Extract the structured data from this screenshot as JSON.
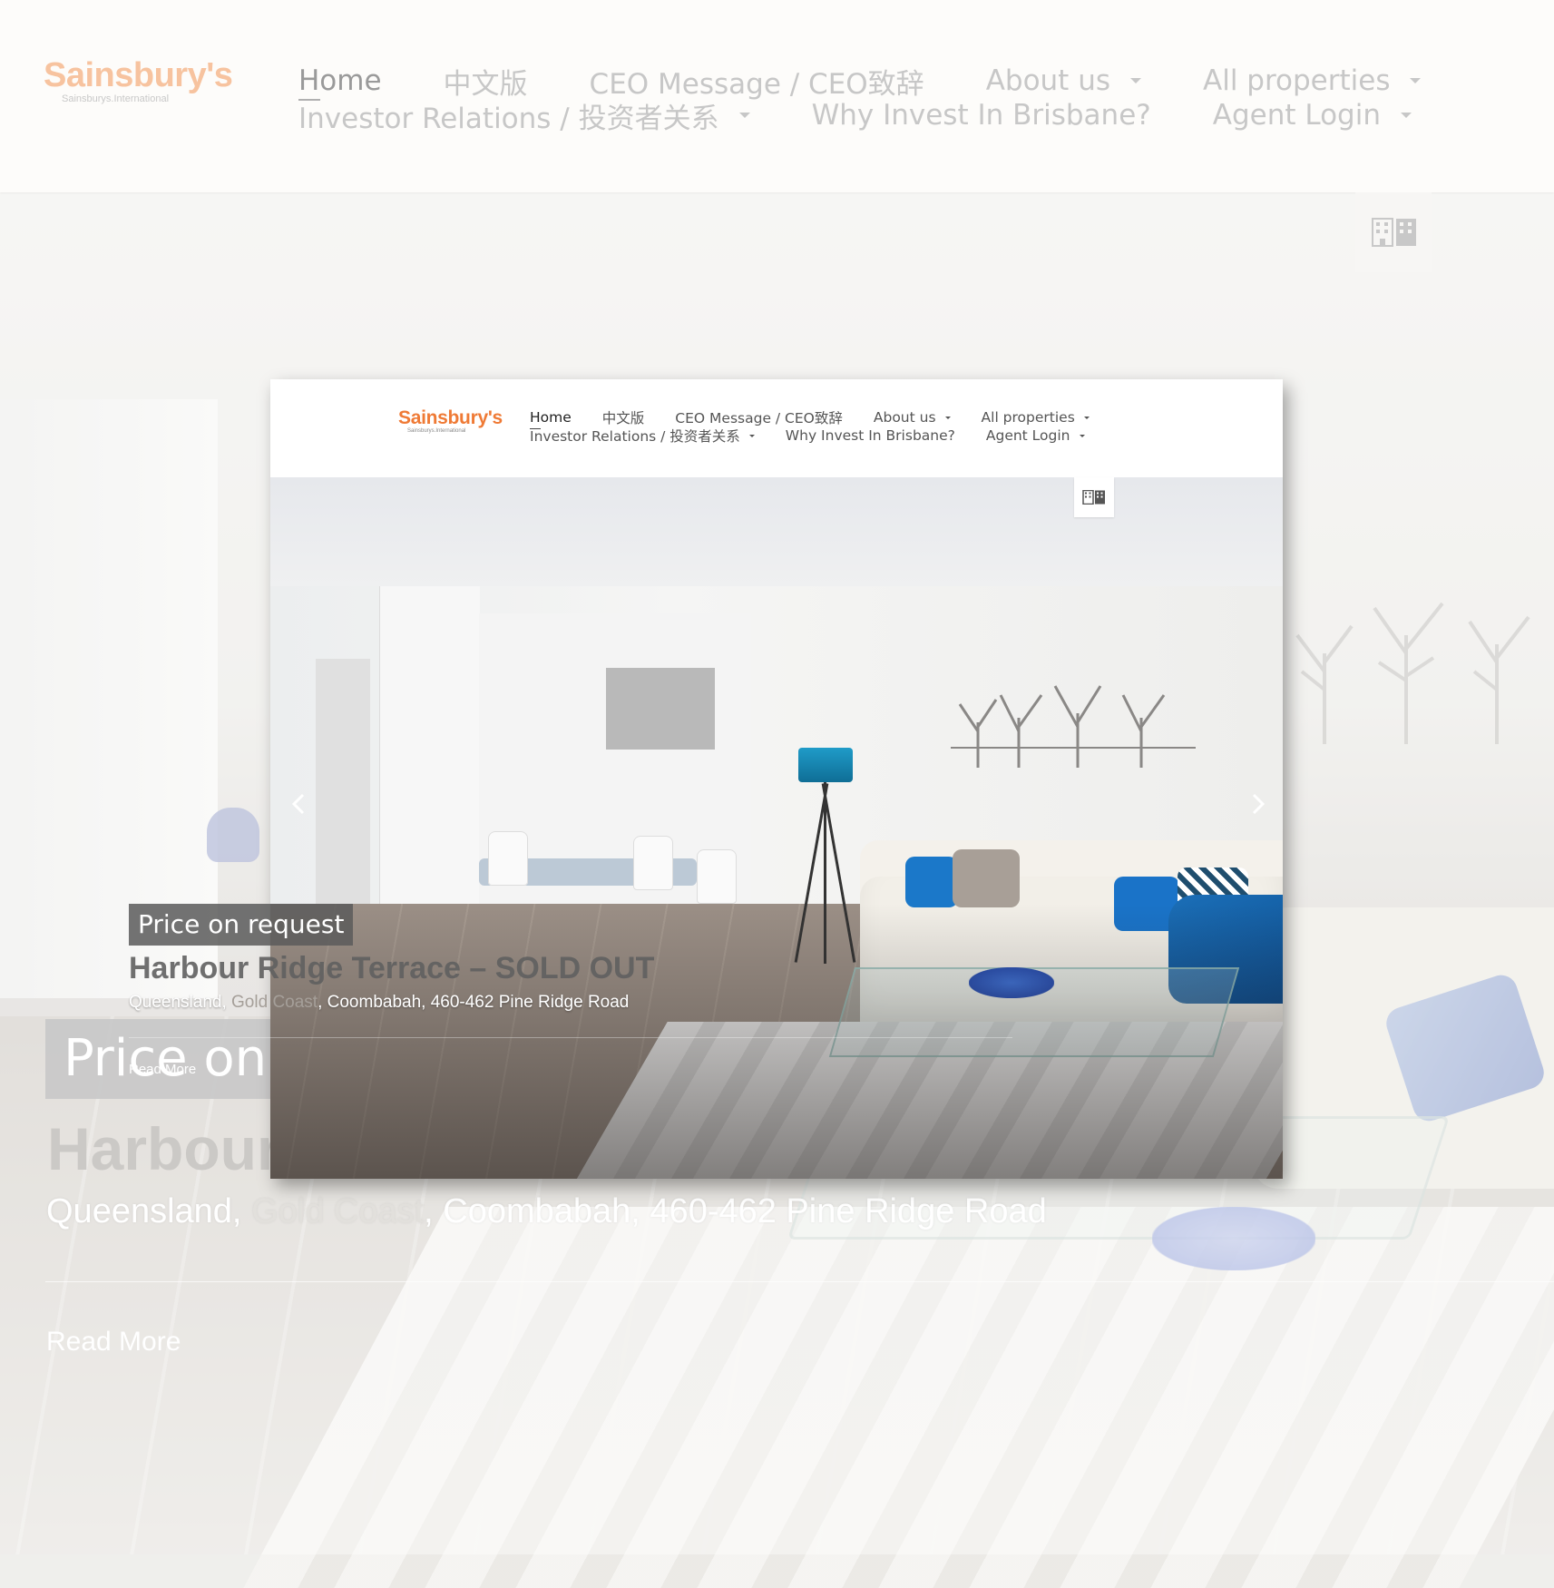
{
  "brand": {
    "name": "Sainsbury's",
    "sub": "Sainsburys.International",
    "accent": "#ef7a35"
  },
  "nav": {
    "row1": [
      {
        "label": "Home",
        "active": true,
        "dropdown": false
      },
      {
        "label": "中文版",
        "dropdown": false
      },
      {
        "label": "CEO Message / CEO致辞",
        "dropdown": false
      },
      {
        "label": "About us",
        "dropdown": true
      },
      {
        "label": "All properties",
        "dropdown": true
      }
    ],
    "row2": [
      {
        "label": "Investor Relations / 投资者关系",
        "dropdown": true
      },
      {
        "label": "Why Invest In Brisbane?",
        "dropdown": false
      },
      {
        "label": "Agent Login",
        "dropdown": true
      }
    ]
  },
  "view_toggle": {
    "icon": "building-icon"
  },
  "slide": {
    "price": "Price on request",
    "title": "Harbour Ridge Terrace – SOLD OUT",
    "address_prefix": "Queensland, ",
    "address_muted": "Gold Coast",
    "address_suffix": ", Coombabah, 460-462 Pine Ridge Road",
    "read_more": "Read More"
  },
  "outer_caption": {
    "price": "Price on",
    "title": "Harbour",
    "address_prefix": "Queensland, ",
    "address_muted": "Gold Coast",
    "address_suffix": ", Coombabah, 460-462 Pine Ridge Road",
    "read_more": "Read More"
  },
  "controls": {
    "prev_icon": "chevron-left-icon",
    "next_icon": "chevron-right-icon"
  }
}
